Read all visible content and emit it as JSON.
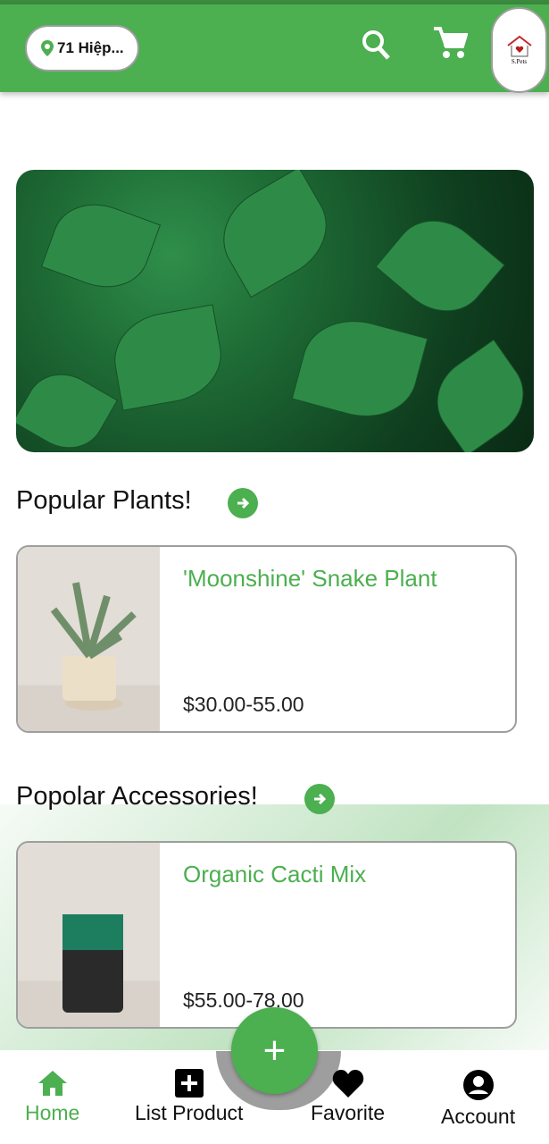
{
  "header": {
    "location": "71 Hiệp...",
    "logo_text": "S.Pets"
  },
  "sections": [
    {
      "title": "Popular Plants!",
      "product": {
        "name": "'Moonshine' Snake Plant",
        "price": "$30.00-55.00"
      }
    },
    {
      "title": "Popolar Accessories!",
      "product": {
        "name": "Organic Cacti Mix",
        "price": "$55.00-78.00"
      }
    }
  ],
  "fab": {
    "label": "+"
  },
  "nav": [
    {
      "label": "Home"
    },
    {
      "label": "List Product"
    },
    {
      "label": "Favorite"
    },
    {
      "label": "Account"
    }
  ],
  "colors": {
    "primary": "#4caf50",
    "header_top": "#3b8a3e"
  }
}
